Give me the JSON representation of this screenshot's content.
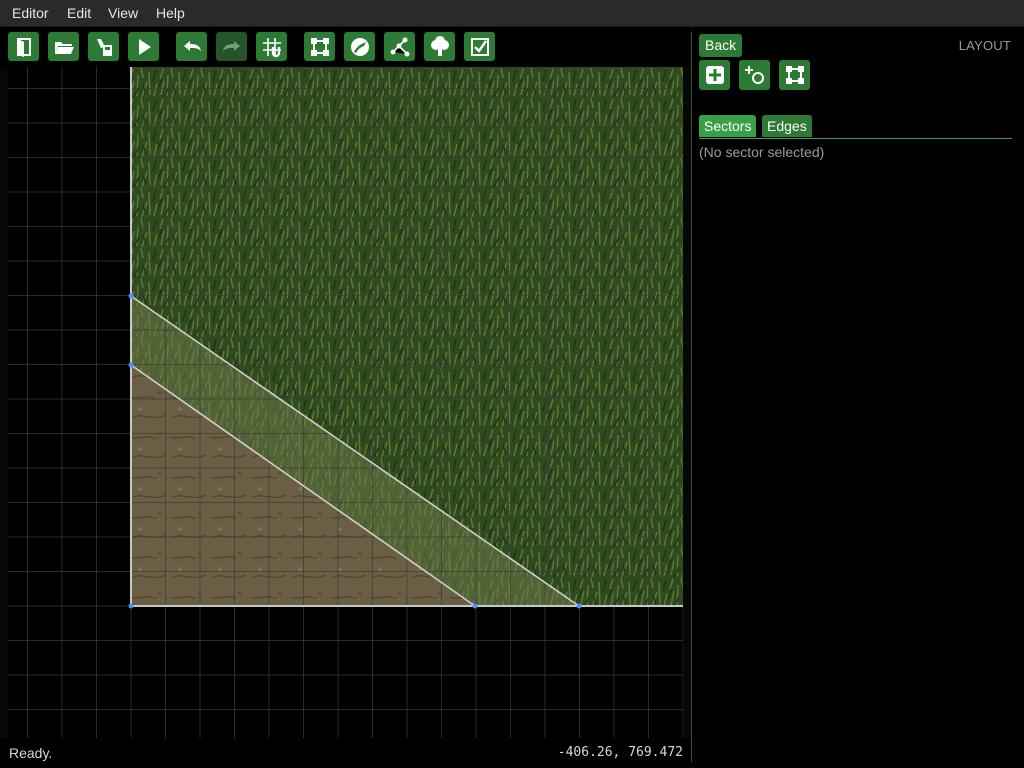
{
  "menubar": {
    "items": [
      {
        "label": "Editor"
      },
      {
        "label": "Edit"
      },
      {
        "label": "View"
      },
      {
        "label": "Help"
      }
    ]
  },
  "toolbar": {
    "buttons": [
      {
        "icon": "exit-door-icon",
        "enabled": true
      },
      {
        "icon": "open-folder-icon",
        "enabled": true
      },
      {
        "icon": "save-icon",
        "enabled": true
      },
      {
        "icon": "play-icon",
        "enabled": true
      },
      {
        "icon": "undo-icon",
        "enabled": true
      },
      {
        "icon": "redo-icon",
        "enabled": false
      },
      {
        "icon": "grid-snap-icon",
        "enabled": true
      },
      {
        "icon": "sector-mode-icon",
        "enabled": true
      },
      {
        "icon": "texture-mode-icon",
        "enabled": true
      },
      {
        "icon": "path-mode-icon",
        "enabled": true
      },
      {
        "icon": "tree-icon",
        "enabled": true
      },
      {
        "icon": "checkmark-icon",
        "enabled": true
      }
    ]
  },
  "panel": {
    "back_label": "Back",
    "mode_label": "LAYOUT",
    "tools": [
      {
        "icon": "add-sector-icon"
      },
      {
        "icon": "add-circle-sector-icon"
      },
      {
        "icon": "sector-shape-icon"
      }
    ],
    "tabs": [
      {
        "label": "Sectors",
        "active": true
      },
      {
        "label": "Edges",
        "active": false
      }
    ],
    "empty_message": "(No sector selected)"
  },
  "status": {
    "message": "Ready.",
    "coords": "-406.26, 769.472"
  },
  "colors": {
    "accent": "#2c7a34",
    "accent_light": "#3aa047",
    "grass_dark": "#2a3d1a",
    "grass_light": "#4e6b2f",
    "dirt": "#6b6147",
    "edge": "#c8c8c8",
    "vertex": "#4a90ff",
    "grid": "#3c3c3c"
  }
}
